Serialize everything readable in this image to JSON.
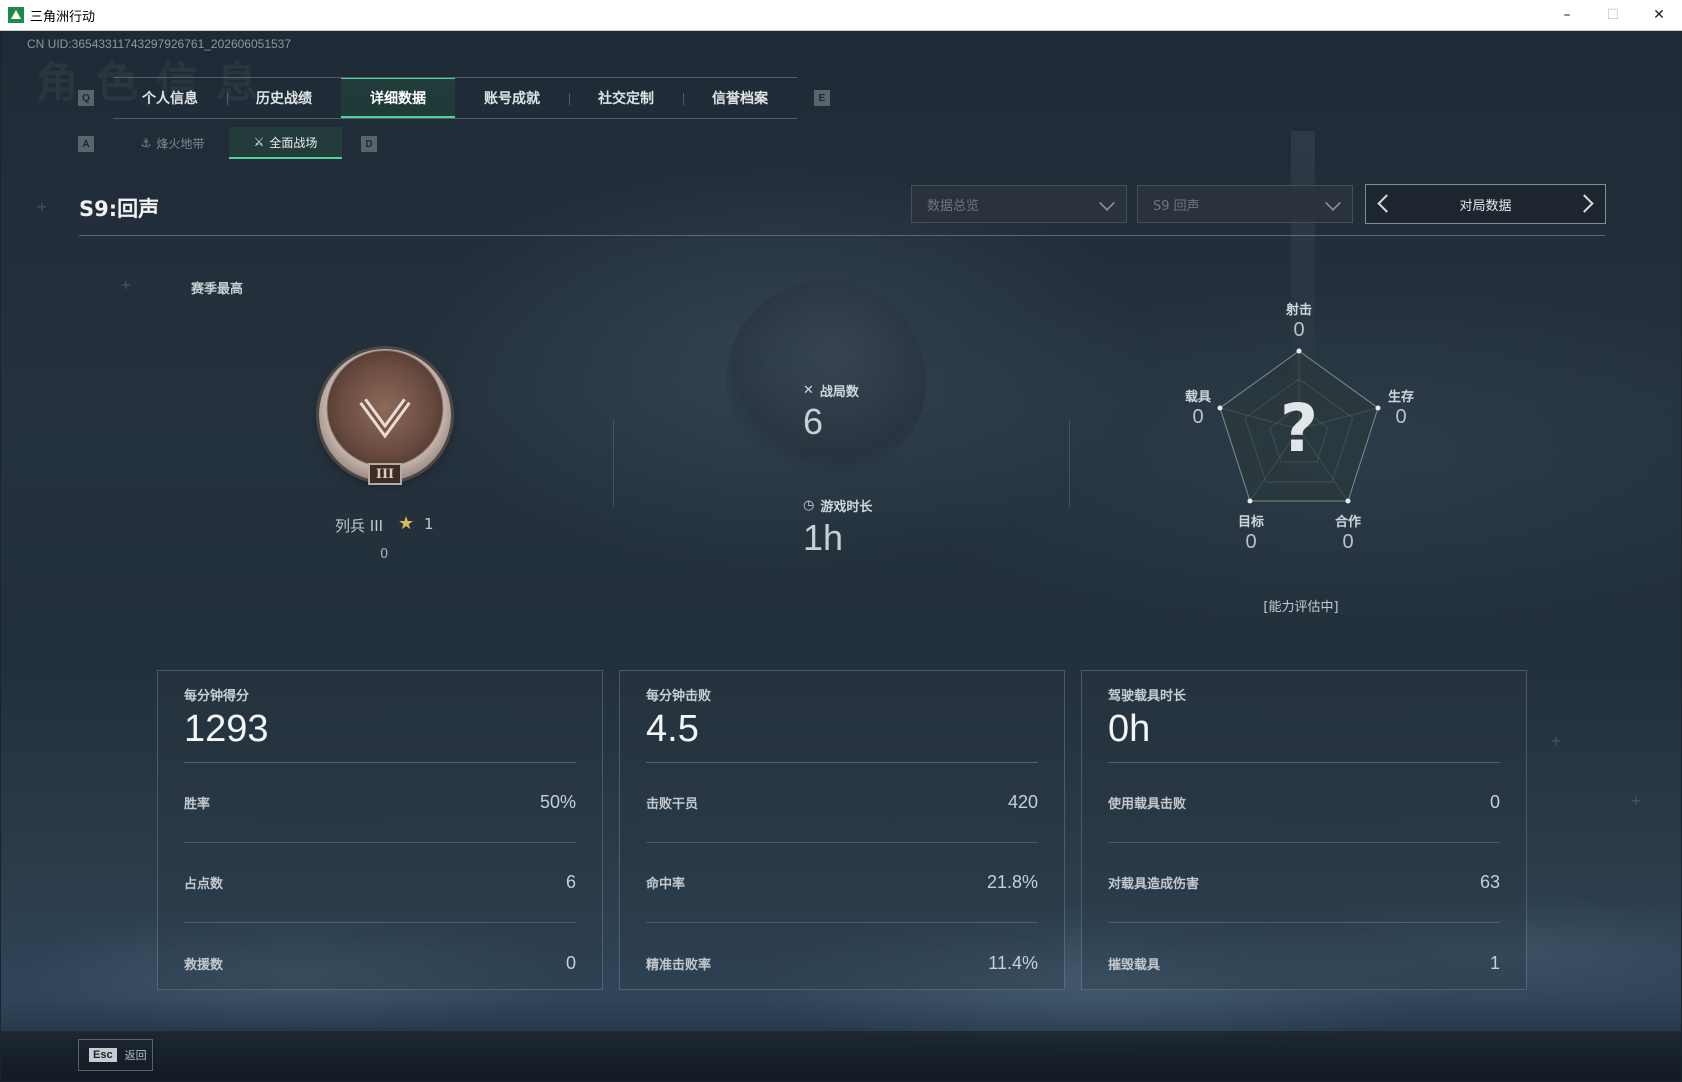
{
  "window": {
    "title": "三角洲行动",
    "minimize": "–",
    "maximize": "☐",
    "close": "✕"
  },
  "uid_text": "CN UID:36543311743297926761_202606051537",
  "watermark": "角色信息",
  "main_tabs": {
    "left_key": "Q",
    "right_key": "E",
    "items": [
      {
        "label": "个人信息",
        "active": false
      },
      {
        "label": "历史战绩",
        "active": false
      },
      {
        "label": "详细数据",
        "active": true
      },
      {
        "label": "账号成就",
        "active": false
      },
      {
        "label": "社交定制",
        "active": false
      },
      {
        "label": "信誉档案",
        "active": false
      }
    ]
  },
  "sub_tabs": {
    "left_key": "A",
    "right_key": "D",
    "items": [
      {
        "label": "烽火地带",
        "active": false,
        "icon": "zone-icon"
      },
      {
        "label": "全面战场",
        "active": true,
        "icon": "battlefield-icon"
      }
    ]
  },
  "season": {
    "title": "S9:回声"
  },
  "filters": {
    "data_type": "数据总览",
    "season_select": "S9 回声",
    "pager_label": "对局数据"
  },
  "rank": {
    "section_label": "赛季最高",
    "roman": "III",
    "name": "列兵 III",
    "stars": "1",
    "points": "0",
    "star_color": "#d9b95b"
  },
  "overview": {
    "matches_label": "战局数",
    "matches_value": "6",
    "playtime_label": "游戏时长",
    "playtime_value": "1h"
  },
  "radar": {
    "center_mark": "?",
    "axes": [
      {
        "label": "射击",
        "value": "0"
      },
      {
        "label": "生存",
        "value": "0"
      },
      {
        "label": "合作",
        "value": "0"
      },
      {
        "label": "目标",
        "value": "0"
      },
      {
        "label": "载具",
        "value": "0"
      }
    ],
    "status": "[能力评估中]"
  },
  "panels": [
    {
      "head_label": "每分钟得分",
      "head_value": "1293",
      "rows": [
        {
          "label": "胜率",
          "value": "50%"
        },
        {
          "label": "占点数",
          "value": "6"
        },
        {
          "label": "救援数",
          "value": "0"
        }
      ]
    },
    {
      "head_label": "每分钟击败",
      "head_value": "4.5",
      "rows": [
        {
          "label": "击败干员",
          "value": "420"
        },
        {
          "label": "命中率",
          "value": "21.8%"
        },
        {
          "label": "精准击败率",
          "value": "11.4%"
        }
      ]
    },
    {
      "head_label": "驾驶载具时长",
      "head_value": "0h",
      "rows": [
        {
          "label": "使用载具击败",
          "value": "0"
        },
        {
          "label": "对载具造成伤害",
          "value": "63"
        },
        {
          "label": "摧毁载具",
          "value": "1"
        }
      ]
    }
  ],
  "footer": {
    "esc_key": "Esc",
    "back_label": "返回"
  },
  "colors": {
    "accent": "#52d39a",
    "background": "#1b2530"
  }
}
